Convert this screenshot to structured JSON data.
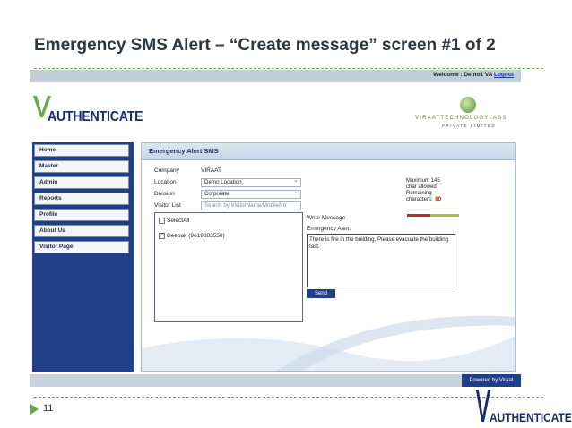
{
  "slide": {
    "title": "Emergency SMS Alert – “Create message” screen #1 of 2",
    "page_number": "11",
    "footer_brand": "AUTHENTICATE"
  },
  "header": {
    "welcome": "Welcome : Demo1 VA",
    "logout": "Logout",
    "brand": "AUTHENTICATE",
    "partner_name": "VIRAATTECHNOLOGYLABS",
    "partner_sub": "PRIVATE LIMITED"
  },
  "sidebar": {
    "items": [
      {
        "label": "Home"
      },
      {
        "label": "Master"
      },
      {
        "label": "Admin"
      },
      {
        "label": "Reports"
      },
      {
        "label": "Profile"
      },
      {
        "label": "About Us"
      },
      {
        "label": "Visitor Page"
      }
    ]
  },
  "form": {
    "title": "Emergency Alert SMS",
    "company_label": "Company",
    "company_value": "VIRAAT",
    "location_label": "Location",
    "location_value": "Demo Location",
    "division_label": "Division",
    "division_value": "Corporate",
    "visitor_list_label": "Visitor List",
    "visitor_search_placeholder": "Search by VisitorName/MobileNo",
    "select_all_label": "SelectAll",
    "select_all_checked": false,
    "visitors": [
      {
        "label": "Deepak (9619883550)",
        "checked": true
      }
    ],
    "write_message_label": "Write Message",
    "message_prefix_label": "Emergency Alert:",
    "message_text": "There is fire in the building, Please evacuate the building fast.",
    "send_label": "Send",
    "limit_line1": "Maximum 145",
    "limit_line2": "char allowed",
    "limit_line3": "Remaining",
    "limit_line4": "characters:",
    "remaining_count": "80",
    "remaining_fraction": 0.55
  },
  "footer": {
    "powered_by": "Powered by Viraat"
  },
  "colors": {
    "accent_blue": "#1f3f86",
    "meter_red": "#d21f1f",
    "meter_green": "#9ccc3a",
    "slide_green": "#6aa84f"
  }
}
